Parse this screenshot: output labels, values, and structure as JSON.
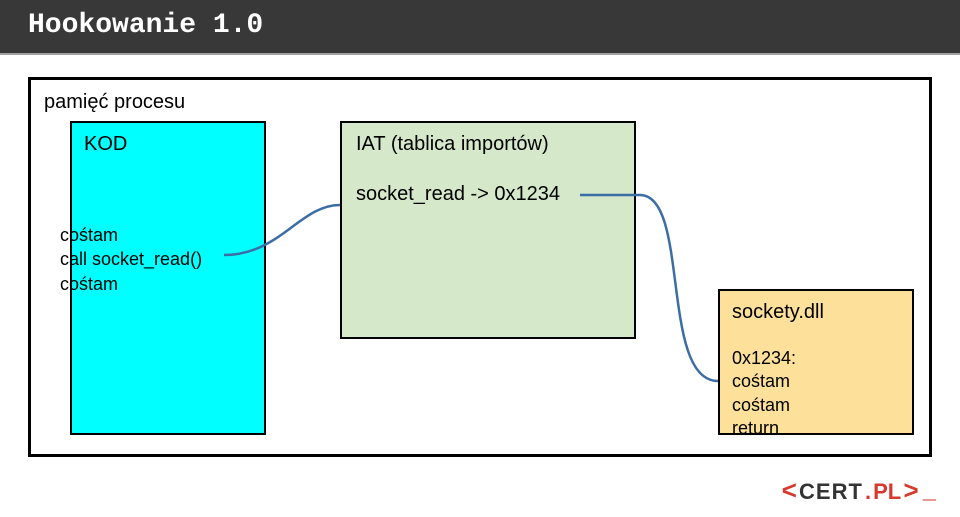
{
  "slide": {
    "title": "Hookowanie 1.0",
    "mem_label": "pamięć procesu",
    "kod": {
      "label": "KOD",
      "line1": "cośtam",
      "line2": "call socket_read()",
      "line3": "cośtam"
    },
    "iat": {
      "label": "IAT (tablica importów)",
      "entry": "socket_read -> 0x1234"
    },
    "dll": {
      "label": "sockety.dll",
      "addr": "0x1234:",
      "line1": " cośtam",
      "line2": " cośtam",
      "line3": " return"
    }
  },
  "logo": {
    "left_angle": "<",
    "cert": "CERT",
    "dot": ".",
    "pl": "PL",
    "right_angle": ">",
    "under": "_"
  },
  "colors": {
    "header_bg": "#383838",
    "kod_bg": "#00ffff",
    "iat_bg": "#d5e8c9",
    "dll_bg": "#fde19a",
    "connector": "#3b6ea5",
    "accent": "#d63a2e"
  }
}
